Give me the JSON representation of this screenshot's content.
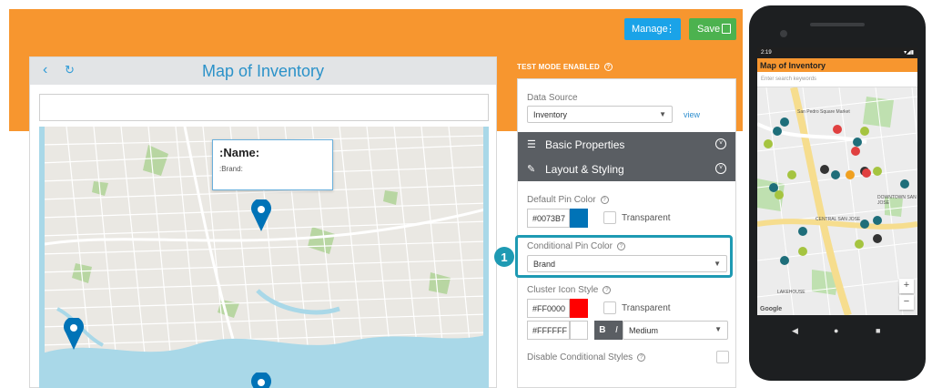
{
  "toolbar": {
    "manage_label": "Manage",
    "manage_dots": "⋮",
    "save_label": "Save"
  },
  "map_panel": {
    "title": "Map of Inventory",
    "back_icon": "‹",
    "refresh_icon": "↻",
    "popup": {
      "name": ":Name:",
      "brand": ":Brand:"
    }
  },
  "settings": {
    "test_mode": "TEST MODE ENABLED",
    "data_source_label": "Data Source",
    "data_source_value": "Inventory",
    "view_link": "view",
    "basic_properties": "Basic Properties",
    "layout_styling": "Layout & Styling",
    "default_pin_color_label": "Default Pin Color",
    "default_pin_color": "#0073B7",
    "transparent_label": "Transparent",
    "conditional_pin_color_label": "Conditional Pin Color",
    "conditional_pin_color_value": "Brand",
    "cluster_icon_style_label": "Cluster Icon Style",
    "cluster_color": "#FF0000",
    "cluster_text_color": "#FFFFFF",
    "font_weight_value": "Medium",
    "bold_label": "B",
    "italic_label": "I",
    "disable_conditional_label": "Disable Conditional Styles",
    "callout_number": "1"
  },
  "phone": {
    "time": "2:19",
    "app_title": "Map of Inventory",
    "search_placeholder": "Enter search keywords",
    "zoom_in": "+",
    "zoom_out": "−",
    "google": "Google",
    "labels": [
      "San Pedro Square Market",
      "CENTRAL SAN JOSE",
      "LAKEHOUSE",
      "DOWNTOWN SAN JOSE"
    ]
  },
  "colors": {
    "accent_orange": "#f7962f",
    "manage_blue": "#1aa3e8",
    "save_green": "#4cb24f",
    "pin_blue": "#0073B7",
    "highlight_teal": "#1e9ab3"
  }
}
